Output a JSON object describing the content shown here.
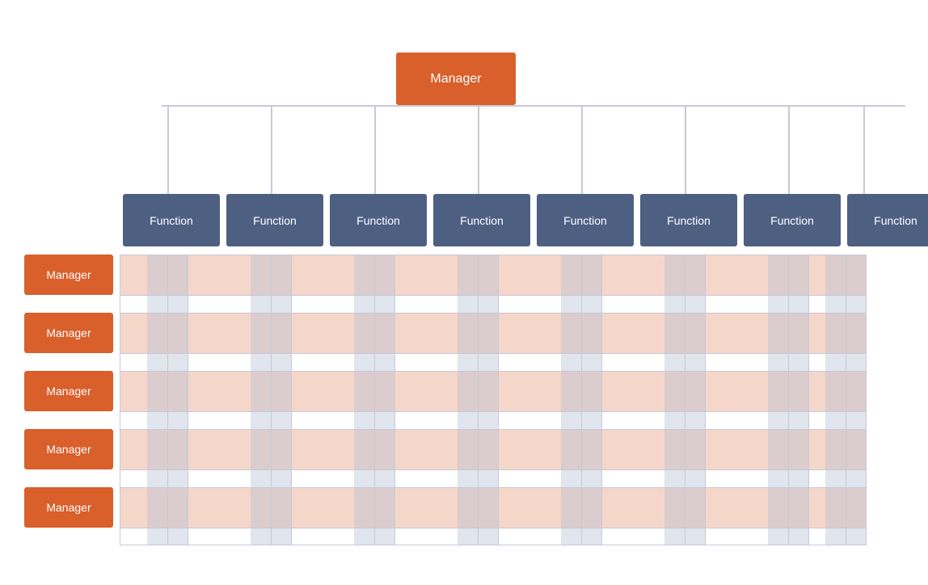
{
  "top_manager": {
    "label": "Manager"
  },
  "functions": [
    {
      "label": "Function"
    },
    {
      "label": "Function"
    },
    {
      "label": "Function"
    },
    {
      "label": "Function"
    },
    {
      "label": "Function"
    },
    {
      "label": "Function"
    },
    {
      "label": "Function"
    },
    {
      "label": "Function"
    }
  ],
  "managers": [
    {
      "label": "Manager"
    },
    {
      "label": "Manager"
    },
    {
      "label": "Manager"
    },
    {
      "label": "Manager"
    },
    {
      "label": "Manager"
    }
  ],
  "colors": {
    "manager_bg": "#d95f2b",
    "function_bg": "#4d6082",
    "grid_line": "#c8c8d8",
    "h_stripe": "rgba(217,95,43,0.25)",
    "v_stripe": "rgba(180,190,210,0.4)"
  }
}
